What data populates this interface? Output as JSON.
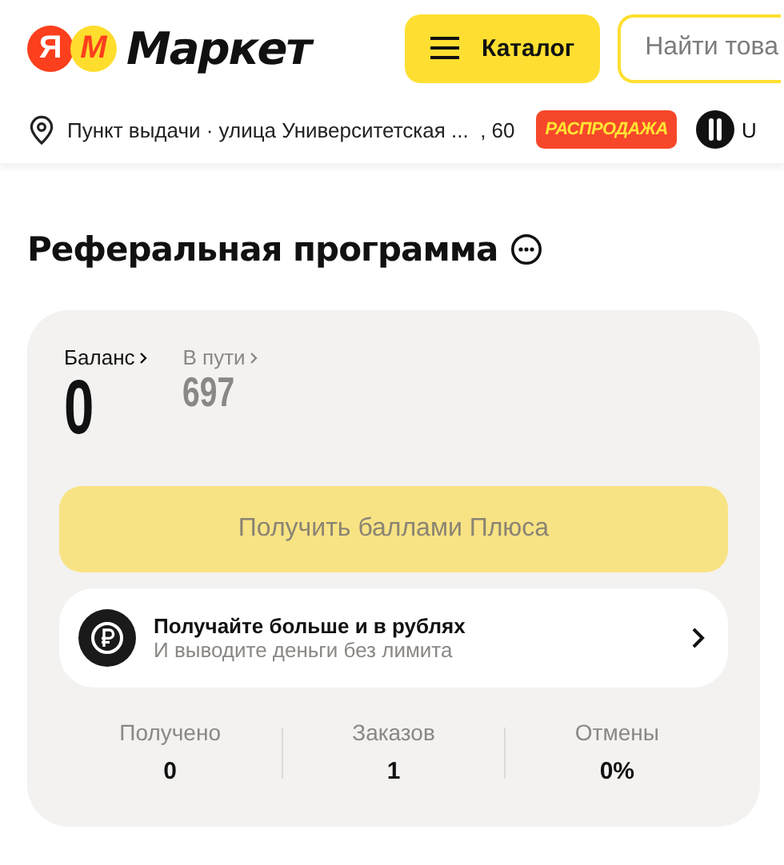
{
  "header": {
    "logo": {
      "ya": "Я",
      "m": "M",
      "word": "Маркет"
    },
    "catalog_button": "Каталог",
    "search": {
      "placeholder": "Найти това"
    }
  },
  "location_bar": {
    "address": "Пункт выдачи · улица Университетская ...  , 60",
    "sale_badge": "РАСПРОДАЖА",
    "partner": "U"
  },
  "page": {
    "title": "Реферальная программа"
  },
  "balance": [
    {
      "label": "Баланс",
      "value": "0",
      "kind": "main"
    },
    {
      "label": "В пути",
      "value": "697",
      "kind": "pending"
    }
  ],
  "withdraw_button": {
    "label": "Получить баллами Плюса",
    "disabled": true
  },
  "promo": {
    "title": "Получайте больше и в рублях",
    "subtitle": "И выводите деньги без лимита"
  },
  "stats": [
    {
      "label": "Получено",
      "value": "0"
    },
    {
      "label": "Заказов",
      "value": "1"
    },
    {
      "label": "Отмены",
      "value": "0%"
    }
  ]
}
